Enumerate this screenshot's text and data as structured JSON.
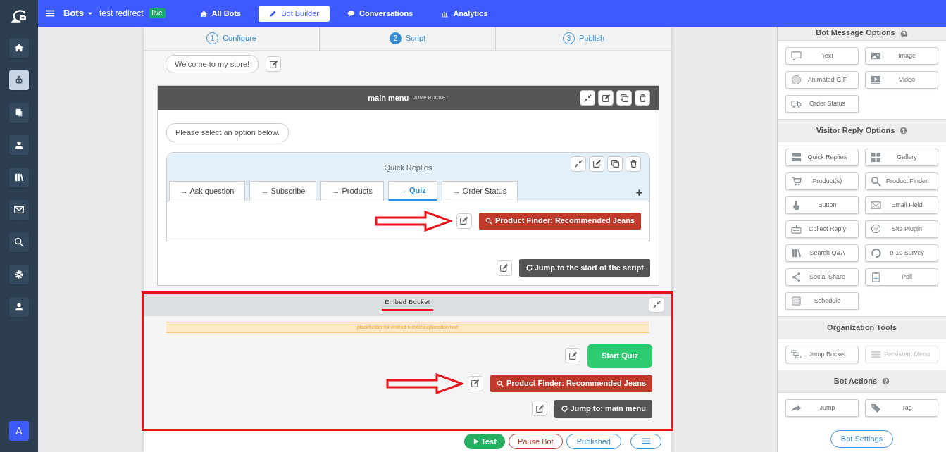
{
  "top_bar": {
    "title": "Bots",
    "bot_name": "test redirect",
    "status_badge": "live",
    "nav": [
      {
        "label": "All Bots",
        "selected": false
      },
      {
        "label": "Bot Builder",
        "selected": true
      },
      {
        "label": "Conversations",
        "selected": false
      },
      {
        "label": "Analytics",
        "selected": false
      }
    ]
  },
  "sidebar": {
    "items": [
      {
        "selected": false
      },
      {
        "selected": true
      },
      {
        "selected": false
      },
      {
        "selected": false
      },
      {
        "selected": false
      },
      {
        "selected": false
      },
      {
        "selected": false
      },
      {
        "selected": false
      },
      {
        "selected": false
      }
    ],
    "avatar": "A"
  },
  "steps": [
    {
      "number": "1",
      "label": "Configure",
      "selected": false
    },
    {
      "number": "2",
      "label": "Script",
      "selected": true
    },
    {
      "number": "3",
      "label": "Publish",
      "selected": false
    }
  ],
  "welcome_message": "Welcome to my store!",
  "jump_bucket": {
    "title": "main menu",
    "subtitle": "JUMP BUCKET",
    "message": "Please select an option below.",
    "quick_replies": {
      "title": "Quick Replies",
      "tabs": [
        {
          "label": "→ Ask question",
          "selected": false
        },
        {
          "label": "→ Subscribe",
          "selected": false
        },
        {
          "label": "→ Products",
          "selected": false
        },
        {
          "label": "→ Quiz",
          "selected": true
        },
        {
          "label": "→ Order Status",
          "selected": false
        }
      ],
      "action": {
        "kind": "finder",
        "label": "Product Finder: Recommended Jeans",
        "arrow": true
      }
    },
    "jump": {
      "kind": "jump",
      "label": "Jump to the start of the script",
      "arrow": false
    }
  },
  "embed_bucket": {
    "title": "Embed Bucket",
    "highlighted": true,
    "underlined": true,
    "note": "placeholder for embed bucket explanation text",
    "actions": [
      {
        "kind": "button",
        "label": "Start Quiz",
        "arrow": false
      },
      {
        "kind": "finder",
        "label": "Product Finder: Recommended Jeans",
        "arrow": true
      },
      {
        "kind": "jump",
        "label": "Jump to: main menu",
        "arrow": false
      }
    ]
  },
  "bottom_bar": {
    "buttons": [
      {
        "kind": "test",
        "label": "Test"
      },
      {
        "kind": "pause",
        "label": "Pause Bot"
      },
      {
        "kind": "published",
        "label": "Published"
      },
      {
        "kind": "menu"
      }
    ]
  },
  "right_panel": {
    "sections": [
      {
        "title": "Bot Message Options",
        "help": true,
        "items": [
          {
            "label": "Text",
            "disabled": false
          },
          {
            "label": "Image",
            "disabled": false
          },
          {
            "label": "Animated GIF",
            "disabled": false
          },
          {
            "label": "Video",
            "disabled": false
          },
          {
            "label": "Order Status",
            "disabled": false
          }
        ]
      },
      {
        "title": "Visitor Reply Options",
        "help": true,
        "items": [
          {
            "label": "Quick Replies",
            "disabled": false
          },
          {
            "label": "Gallery",
            "disabled": false
          },
          {
            "label": "Product(s)",
            "disabled": false
          },
          {
            "label": "Product Finder",
            "disabled": false
          },
          {
            "label": "Button",
            "disabled": false
          },
          {
            "label": "Email Field",
            "disabled": false
          },
          {
            "label": "Collect Reply",
            "disabled": false
          },
          {
            "label": "Site Plugin",
            "disabled": false
          },
          {
            "label": "Search Q&A",
            "disabled": false
          },
          {
            "label": "0-10 Survey",
            "disabled": false
          },
          {
            "label": "Social Share",
            "disabled": false
          },
          {
            "label": "Poll",
            "disabled": false
          },
          {
            "label": "Schedule",
            "disabled": false
          }
        ]
      },
      {
        "title": "Organization Tools",
        "help": false,
        "items": [
          {
            "label": "Jump Bucket",
            "disabled": false
          },
          {
            "label": "Persistent Menu",
            "disabled": true
          }
        ]
      },
      {
        "title": "Bot Actions",
        "help": true,
        "items": [
          {
            "label": "Jump",
            "disabled": false
          },
          {
            "label": "Tag",
            "disabled": false
          }
        ]
      }
    ],
    "settings_button": "Bot Settings"
  }
}
